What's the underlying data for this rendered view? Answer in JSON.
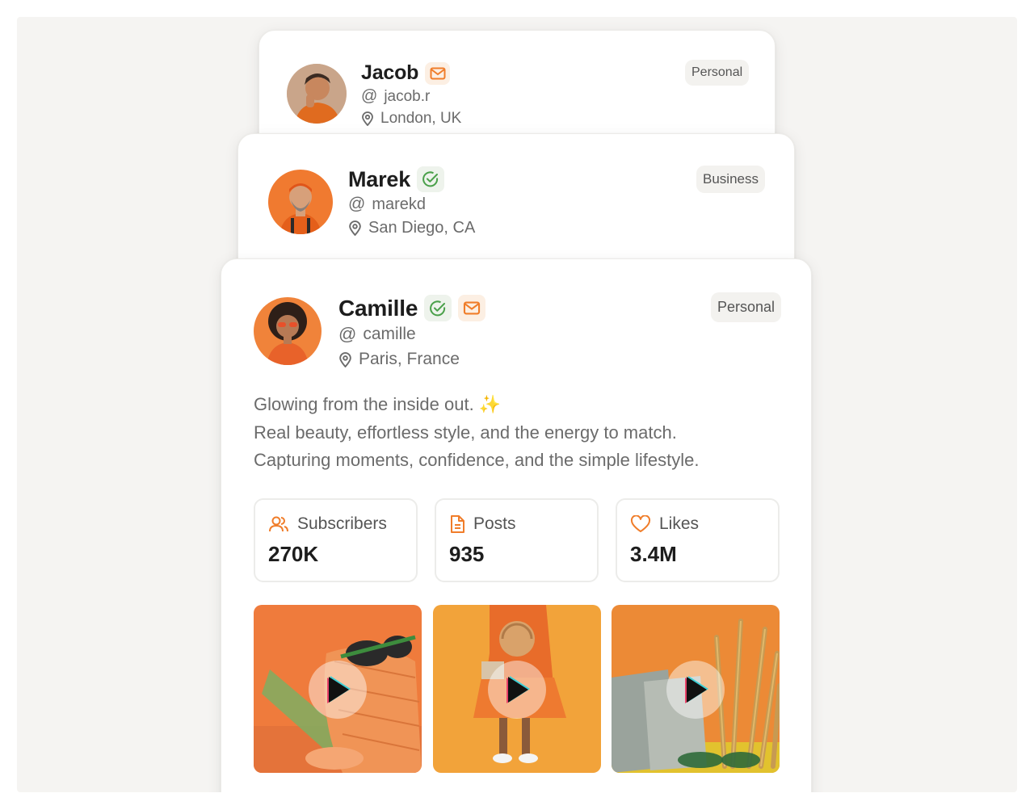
{
  "profiles": {
    "jacob": {
      "name": "Jacob",
      "handle": "jacob.r",
      "location": "London, UK",
      "tag": "Personal"
    },
    "marek": {
      "name": "Marek",
      "handle": "marekd",
      "location": "San Diego, CA",
      "tag": "Business"
    },
    "camille": {
      "name": "Camille",
      "handle": "camille",
      "location": "Paris, France",
      "tag": "Personal",
      "bio": [
        "Glowing from the inside out. ✨",
        "Real beauty, effortless style, and the energy to match.",
        "Capturing moments, confidence, and the simple lifestyle."
      ],
      "stats": [
        {
          "label": "Subscribers",
          "value": "270K",
          "icon": "users-icon"
        },
        {
          "label": "Posts",
          "value": "935",
          "icon": "document-icon"
        },
        {
          "label": "Likes",
          "value": "3.4M",
          "icon": "heart-icon"
        }
      ],
      "videos": [
        {
          "subject": "sunglasses-on-handbag",
          "icon": "play-icon"
        },
        {
          "subject": "person-holding-straw-hat",
          "icon": "play-icon"
        },
        {
          "subject": "dried-wheat-and-sunglasses",
          "icon": "play-icon"
        }
      ]
    }
  },
  "colors": {
    "accent": "#f07d2a",
    "verified": "#4aa04a",
    "stage": "#f5f4f2"
  },
  "at_symbol": "@"
}
